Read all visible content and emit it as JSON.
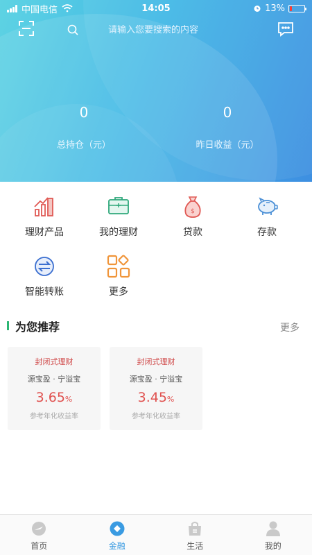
{
  "status_bar": {
    "carrier": "中国电信",
    "time": "14:05",
    "battery_percent": "13%",
    "battery_level": 0.13
  },
  "header": {
    "search_placeholder": "请输入您要搜索的内容",
    "total_holdings_value": "0",
    "total_holdings_label": "总持仓（元）",
    "yesterday_income_value": "0",
    "yesterday_income_label": "昨日收益（元）",
    "gradient_colors": [
      "#5ed3e3",
      "#3e8fe1"
    ]
  },
  "menu": {
    "items": [
      {
        "label": "理财产品",
        "icon": "chart-growth-icon"
      },
      {
        "label": "我的理财",
        "icon": "briefcase-icon"
      },
      {
        "label": "贷款",
        "icon": "money-bag-icon"
      },
      {
        "label": "存款",
        "icon": "piggy-bank-icon"
      },
      {
        "label": "智能转账",
        "icon": "transfer-icon"
      },
      {
        "label": "更多",
        "icon": "more-grid-icon"
      }
    ]
  },
  "recommend": {
    "title": "为您推荐",
    "more_label": "更多",
    "accent": "#2bb673",
    "cards": [
      {
        "type": "封闭式理财",
        "name": "源宝盈 · 宁溢宝",
        "rate": "3.65",
        "unit": "%",
        "desc": "参考年化收益率"
      },
      {
        "type": "封闭式理财",
        "name": "源宝盈 · 宁溢宝",
        "rate": "3.45",
        "unit": "%",
        "desc": "参考年化收益率"
      }
    ]
  },
  "tabbar": {
    "active": "金融",
    "active_color": "#3a9be2",
    "tabs": [
      {
        "label": "首页",
        "icon": "compass-icon"
      },
      {
        "label": "金融",
        "icon": "finance-icon"
      },
      {
        "label": "生活",
        "icon": "life-bag-icon"
      },
      {
        "label": "我的",
        "icon": "profile-icon"
      }
    ]
  }
}
